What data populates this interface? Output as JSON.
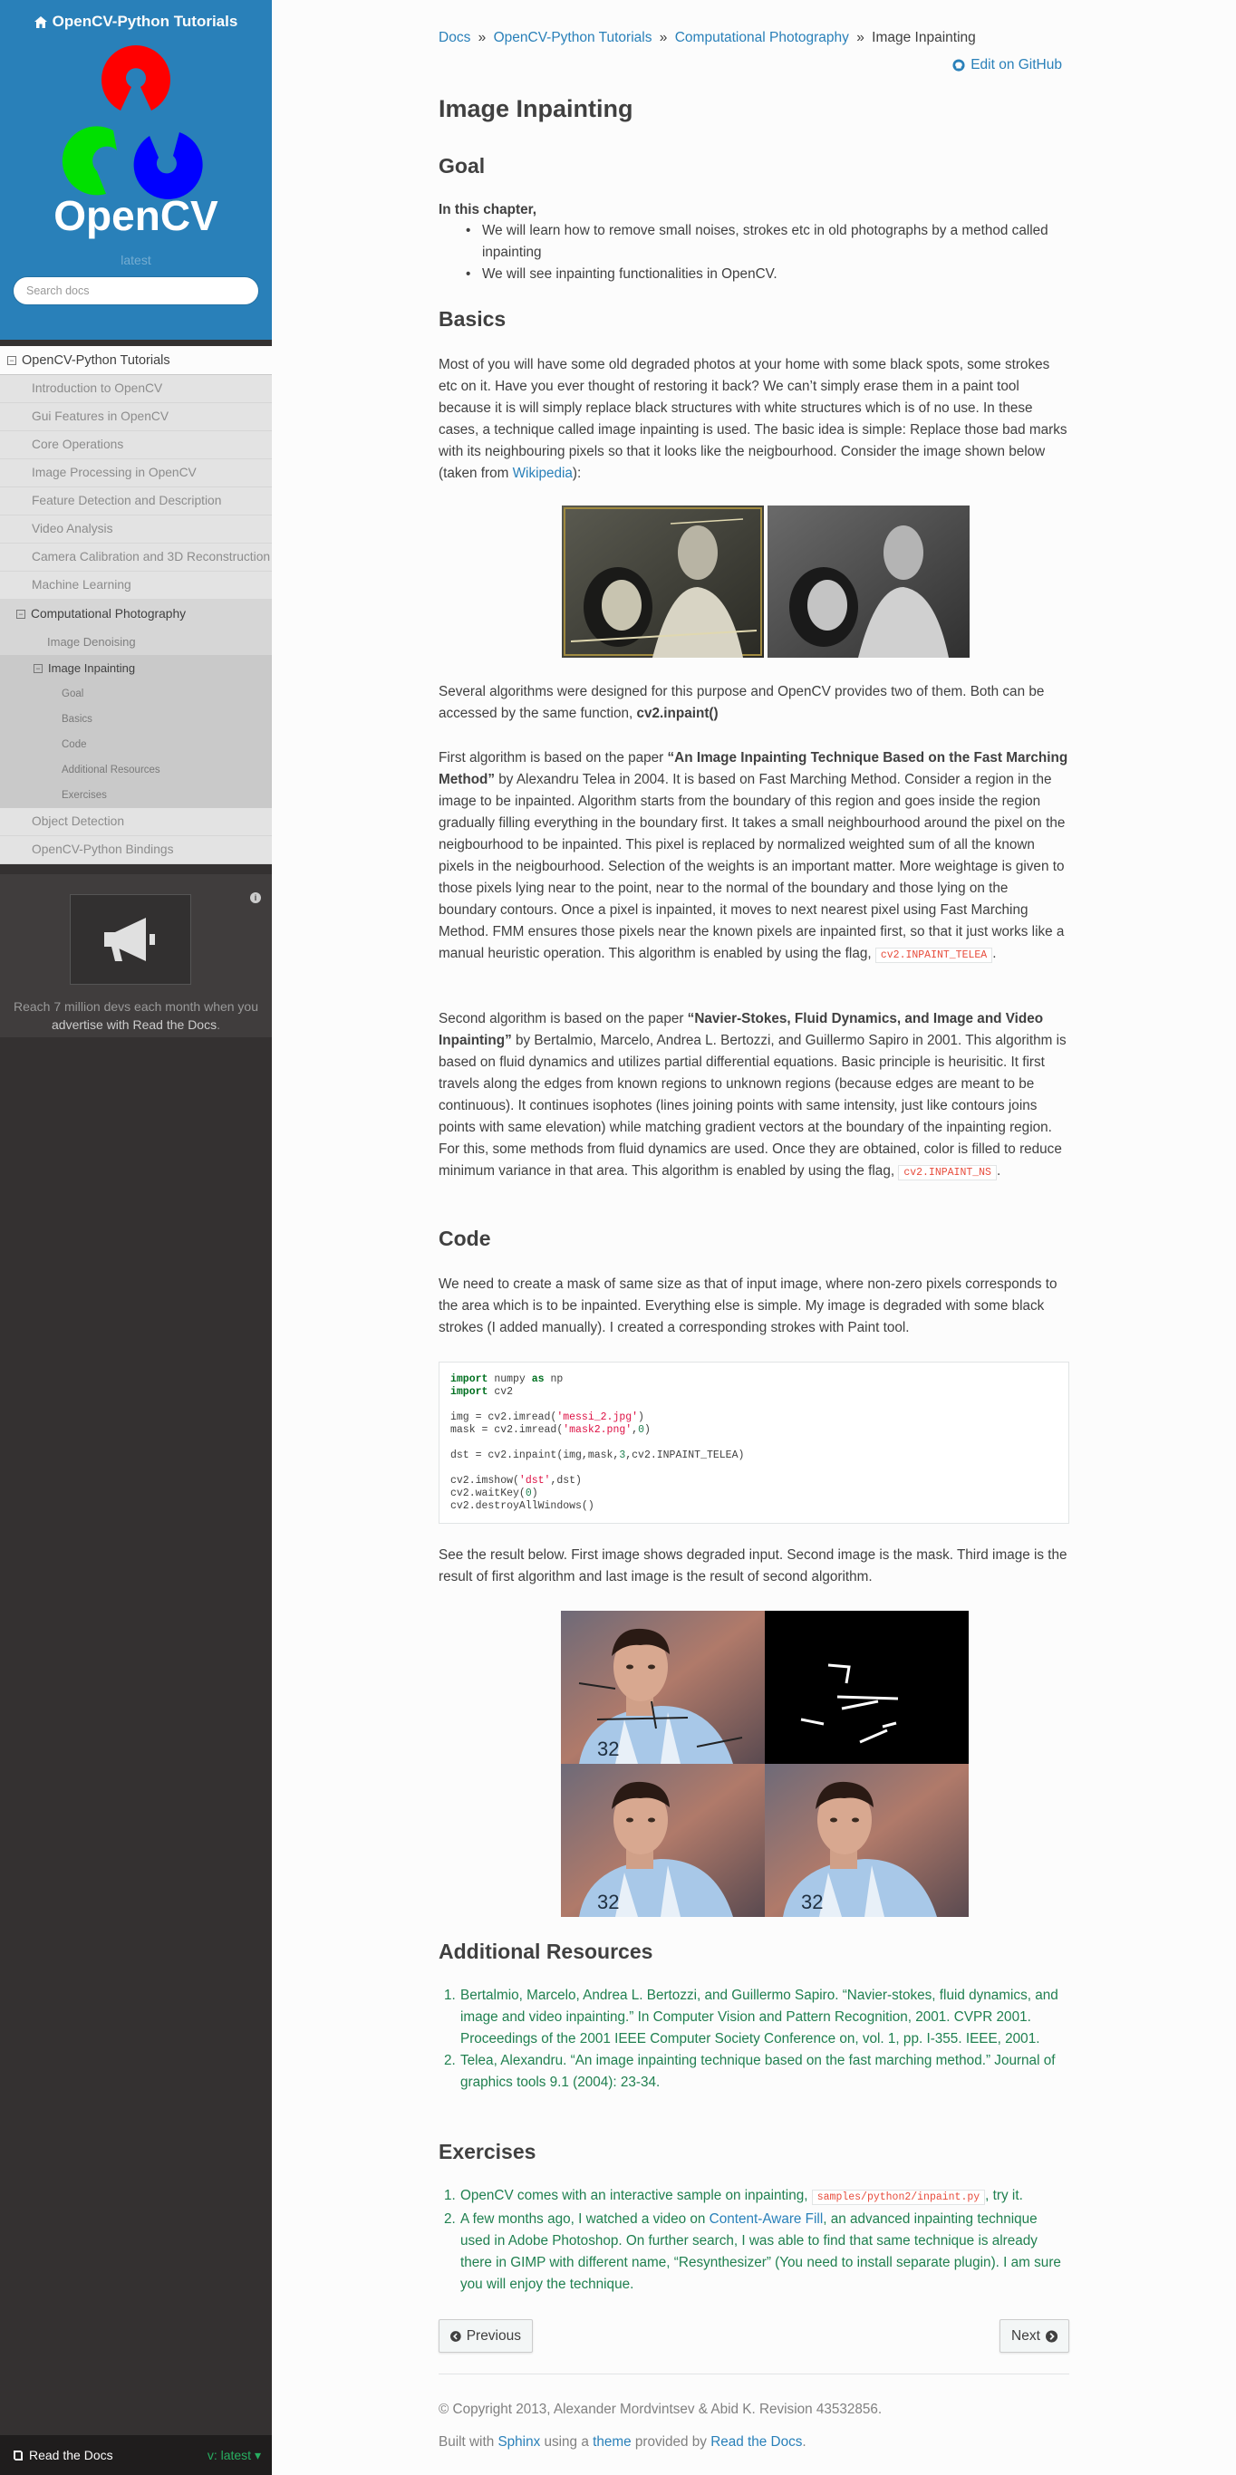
{
  "sidebar": {
    "project_title": "OpenCV-Python Tutorials",
    "logo_text": "OpenCV",
    "version": "latest",
    "search_placeholder": "Search docs",
    "nav": [
      {
        "label": "OpenCV-Python Tutorials",
        "level": 1,
        "expanded": true
      },
      {
        "label": "Introduction to OpenCV",
        "level": 2
      },
      {
        "label": "Gui Features in OpenCV",
        "level": 2
      },
      {
        "label": "Core Operations",
        "level": 2
      },
      {
        "label": "Image Processing in OpenCV",
        "level": 2
      },
      {
        "label": "Feature Detection and Description",
        "level": 2
      },
      {
        "label": "Video Analysis",
        "level": 2
      },
      {
        "label": "Camera Calibration and 3D Reconstruction",
        "level": 2
      },
      {
        "label": "Machine Learning",
        "level": 2
      },
      {
        "label": "Computational Photography",
        "level": 2,
        "expanded": true
      },
      {
        "label": "Image Denoising",
        "level": 3
      },
      {
        "label": "Image Inpainting",
        "level": 3,
        "expanded": true
      },
      {
        "label": "Goal",
        "level": 4
      },
      {
        "label": "Basics",
        "level": 4
      },
      {
        "label": "Code",
        "level": 4
      },
      {
        "label": "Additional Resources",
        "level": 4
      },
      {
        "label": "Exercises",
        "level": 4
      },
      {
        "label": "Object Detection",
        "level": 2
      },
      {
        "label": "OpenCV-Python Bindings",
        "level": 2
      }
    ],
    "ad_text_1": "Reach 7 million devs each month when you",
    "ad_text_2": "advertise with Read the Docs",
    "ad_text_3": ".",
    "rtd_label": "Read the Docs",
    "rtd_version": "v: latest",
    "colors": {
      "sidebar_top": "#2980b9",
      "sidebar_bg": "#343131",
      "accent": "#2980b9"
    }
  },
  "breadcrumb": {
    "docs": "Docs",
    "tutorials": "OpenCV-Python Tutorials",
    "section": "Computational Photography",
    "current": "Image Inpainting",
    "sep": "»",
    "edit": "Edit on GitHub"
  },
  "page": {
    "title": "Image Inpainting",
    "goal": {
      "heading": "Goal",
      "intro": "In this chapter,",
      "bullets": [
        "We will learn how to remove small noises, strokes etc in old photographs by a method called inpainting",
        "We will see inpainting functionalities in OpenCV."
      ]
    },
    "basics": {
      "heading": "Basics",
      "p1_a": "Most of you will have some old degraded photos at your home with some black spots, some strokes etc on it. Have you ever thought of restoring it back? We can’t simply erase them in a paint tool because it is will simply replace black structures with white structures which is of no use. In these cases, a technique called image inpainting is used. The basic idea is simple: Replace those bad marks with its neighbouring pixels so that it looks like the neigbourhood. Consider the image shown below (taken from ",
      "p1_link": "Wikipedia",
      "p1_b": "):",
      "p2_a": "Several algorithms were designed for this purpose and OpenCV provides two of them. Both can be accessed by the same function, ",
      "p2_func": "cv2.inpaint()",
      "p3_a": "First algorithm is based on the paper ",
      "p3_paper": "“An Image Inpainting Technique Based on the Fast Marching Method”",
      "p3_b": " by Alexandru Telea in 2004. It is based on Fast Marching Method. Consider a region in the image to be inpainted. Algorithm starts from the boundary of this region and goes inside the region gradually filling everything in the boundary first. It takes a small neighbourhood around the pixel on the neigbourhood to be inpainted. This pixel is replaced by normalized weighted sum of all the known pixels in the neigbourhood. Selection of the weights is an important matter. More weightage is given to those pixels lying near to the point, near to the normal of the boundary and those lying on the boundary contours. Once a pixel is inpainted, it moves to next nearest pixel using Fast Marching Method. FMM ensures those pixels near the known pixels are inpainted first, so that it just works like a manual heuristic operation. This algorithm is enabled by using the flag, ",
      "p3_flag": "cv2.INPAINT_TELEA",
      "p3_c": ".",
      "p4_a": "Second algorithm is based on the paper ",
      "p4_paper": "“Navier-Stokes, Fluid Dynamics, and Image and Video Inpainting”",
      "p4_b": " by Bertalmio, Marcelo, Andrea L. Bertozzi, and Guillermo Sapiro in 2001. This algorithm is based on fluid dynamics and utilizes partial differential equations. Basic principle is heurisitic. It first travels along the edges from known regions to unknown regions (because edges are meant to be continuous). It continues isophotes (lines joining points with same intensity, just like contours joins points with same elevation) while matching gradient vectors at the boundary of the inpainting region. For this, some methods from fluid dynamics are used. Once they are obtained, color is filled to reduce minimum variance in that area. This algorithm is enabled by using the flag, ",
      "p4_flag": "cv2.INPAINT_NS",
      "p4_c": "."
    },
    "code": {
      "heading": "Code",
      "p1": "We need to create a mask of same size as that of input image, where non-zero pixels corresponds to the area which is to be inpainted. Everything else is simple. My image is degraded with some black strokes (I added manually). I created a corresponding strokes with Paint tool.",
      "lines": {
        "l1_kw": "import",
        "l1_rest": " numpy ",
        "l1_as": "as",
        "l1_np": " np",
        "l2_kw": "import",
        "l2_rest": " cv2",
        "l4_a": "img = cv2.imread(",
        "l4_s": "'messi_2.jpg'",
        "l4_b": ")",
        "l5_a": "mask = cv2.imread(",
        "l5_s": "'mask2.png'",
        "l5_b": ",",
        "l5_n": "0",
        "l5_c": ")",
        "l7_a": "dst = cv2.inpaint(img,mask,",
        "l7_n": "3",
        "l7_b": ",cv2.INPAINT_TELEA)",
        "l9_a": "cv2.imshow(",
        "l9_s": "'dst'",
        "l9_b": ",dst)",
        "l10_a": "cv2.waitKey(",
        "l10_n": "0",
        "l10_b": ")",
        "l11": "cv2.destroyAllWindows()"
      },
      "p2": "See the result below. First image shows degraded input. Second image is the mask. Third image is the result of first algorithm and last image is the result of second algorithm."
    },
    "resources": {
      "heading": "Additional Resources",
      "items": [
        "Bertalmio, Marcelo, Andrea L. Bertozzi, and Guillermo Sapiro. “Navier-stokes, fluid dynamics, and image and video inpainting.” In Computer Vision and Pattern Recognition, 2001. CVPR 2001. Proceedings of the 2001 IEEE Computer Society Conference on, vol. 1, pp. I-355. IEEE, 2001.",
        "Telea, Alexandru. “An image inpainting technique based on the fast marching method.” Journal of graphics tools 9.1 (2004): 23-34."
      ]
    },
    "exercises": {
      "heading": "Exercises",
      "e1_a": "OpenCV comes with an interactive sample on inpainting, ",
      "e1_code": "samples/python2/inpaint.py",
      "e1_b": ", try it.",
      "e2_a": "A few months ago, I watched a video on ",
      "e2_link": "Content-Aware Fill",
      "e2_b": ", an advanced inpainting technique used in Adobe Photoshop. On further search, I was able to find that same technique is already there in GIMP with different name, “Resynthesizer” (You need to install separate plugin). I am sure you will enjoy the technique."
    }
  },
  "footer": {
    "previous": "Previous",
    "next": "Next",
    "copyright": "© Copyright 2013, Alexander Mordvintsev & Abid K. Revision 43532856.",
    "built_a": "Built with ",
    "sphinx": "Sphinx",
    "built_b": " using a ",
    "theme": "theme",
    "built_c": " provided by ",
    "rtd": "Read the Docs",
    "built_d": "."
  }
}
